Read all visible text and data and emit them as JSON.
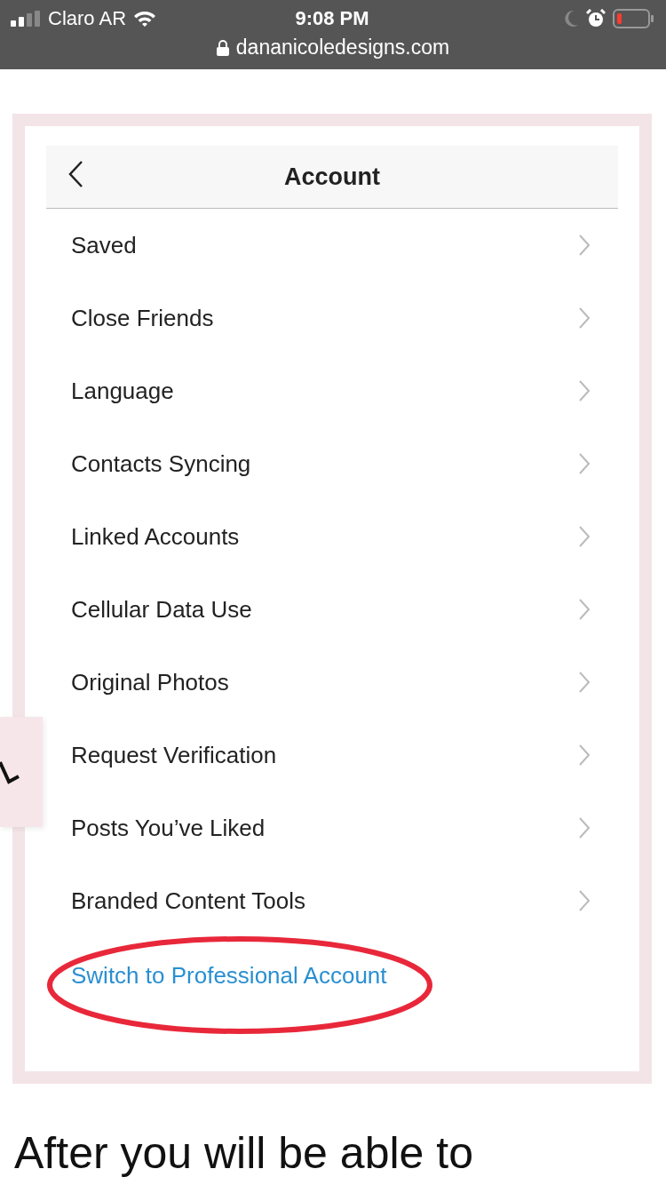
{
  "status_bar": {
    "carrier": "Claro AR",
    "time": "9:08 PM",
    "url": "dananicoledesigns.com"
  },
  "screen": {
    "title": "Account",
    "items": [
      {
        "label": "Saved"
      },
      {
        "label": "Close Friends"
      },
      {
        "label": "Language"
      },
      {
        "label": "Contacts Syncing"
      },
      {
        "label": "Linked Accounts"
      },
      {
        "label": "Cellular Data Use"
      },
      {
        "label": "Original Photos"
      },
      {
        "label": "Request Verification"
      },
      {
        "label": "Posts You’ve Liked"
      },
      {
        "label": "Branded Content Tools"
      }
    ],
    "link": "Switch to Professional Account"
  },
  "body_text": "After you will be able to"
}
